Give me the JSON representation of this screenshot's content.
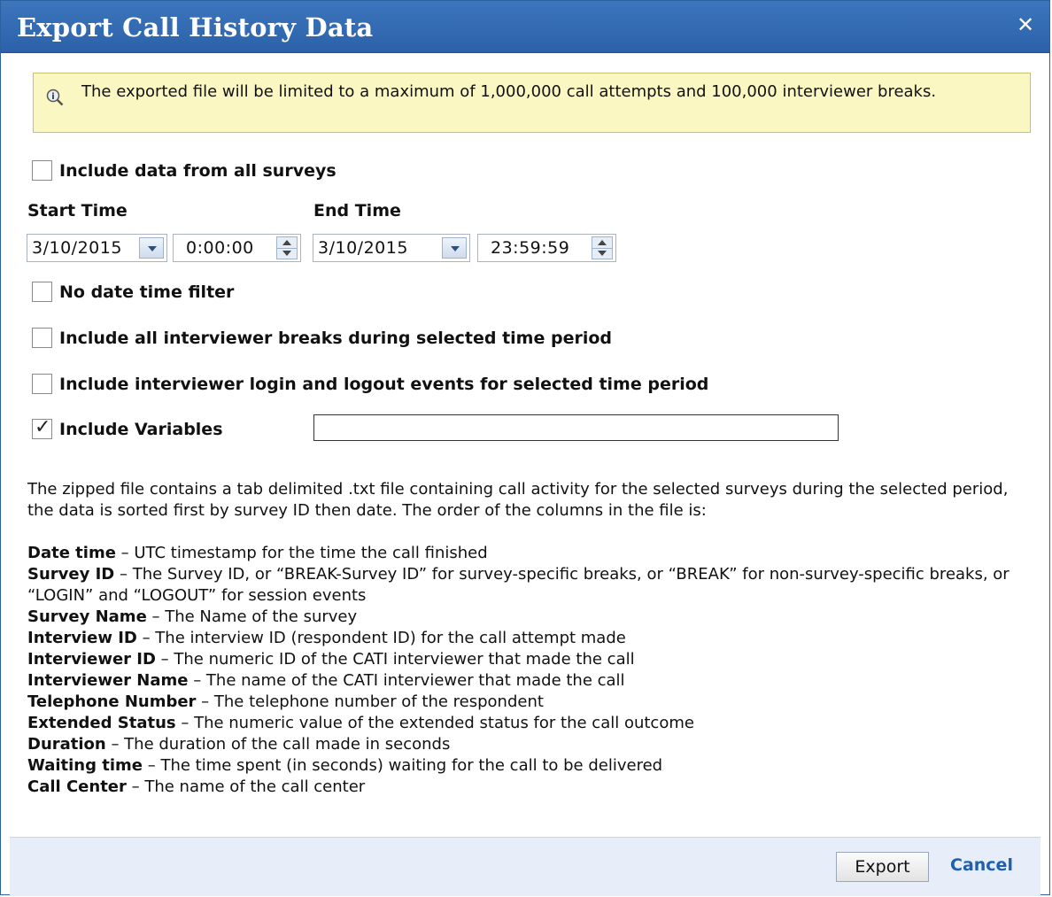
{
  "dialog": {
    "title": "Export Call History Data",
    "close_glyph": "✕"
  },
  "notice": {
    "icon": "info-magnifier-icon",
    "text": "The exported file will be limited to a maximum of 1,000,000 call attempts and 100,000 interviewer breaks."
  },
  "options": {
    "all_surveys": {
      "label": "Include data from all surveys",
      "checked": false
    },
    "no_date_filter": {
      "label": "No date time filter",
      "checked": false
    },
    "breaks": {
      "label": "Include all interviewer breaks during selected time period",
      "checked": false
    },
    "login_events": {
      "label": "Include interviewer login and logout events for selected time period",
      "checked": false
    },
    "variables": {
      "label": "Include Variables",
      "checked": true,
      "value": ""
    }
  },
  "start": {
    "label": "Start Time",
    "date": "3/10/2015",
    "time": "0:00:00"
  },
  "end": {
    "label": "End Time",
    "date": "3/10/2015",
    "time": "23:59:59"
  },
  "description": "The zipped file contains a tab delimited .txt file containing call activity for the selected surveys during the selected period, the data is sorted first by survey ID then date. The order of the columns in the file is:",
  "fields": [
    {
      "name": "Date time",
      "text": " – UTC timestamp for the time the call finished"
    },
    {
      "name": "Survey ID",
      "text": " – The Survey ID, or “BREAK-Survey ID” for survey-specific breaks, or “BREAK” for non-survey-specific breaks, or “LOGIN” and “LOGOUT” for session events"
    },
    {
      "name": "Survey Name",
      "text": " – The Name of the survey"
    },
    {
      "name": "Interview ID",
      "text": " – The interview ID (respondent ID) for the call attempt made"
    },
    {
      "name": "Interviewer ID",
      "text": " – The numeric ID of the CATI interviewer that made the call"
    },
    {
      "name": "Interviewer Name",
      "text": " – The name of the CATI interviewer that made the call"
    },
    {
      "name": "Telephone Number",
      "text": " – The telephone number of the respondent"
    },
    {
      "name": "Extended Status",
      "text": " – The numeric value of the extended status for the call outcome"
    },
    {
      "name": "Duration",
      "text": " – The duration of the call made in seconds"
    },
    {
      "name": "Waiting time",
      "text": " – The time spent (in seconds) waiting for the call to be delivered"
    },
    {
      "name": "Call Center",
      "text": " – The name of the call center"
    }
  ],
  "footer": {
    "export_label": "Export",
    "cancel_label": "Cancel"
  },
  "colors": {
    "titlebar": "#3366aa",
    "notice_bg": "#fbf7c3",
    "link": "#1f5fb0",
    "footer_bg": "#e7eef9"
  }
}
